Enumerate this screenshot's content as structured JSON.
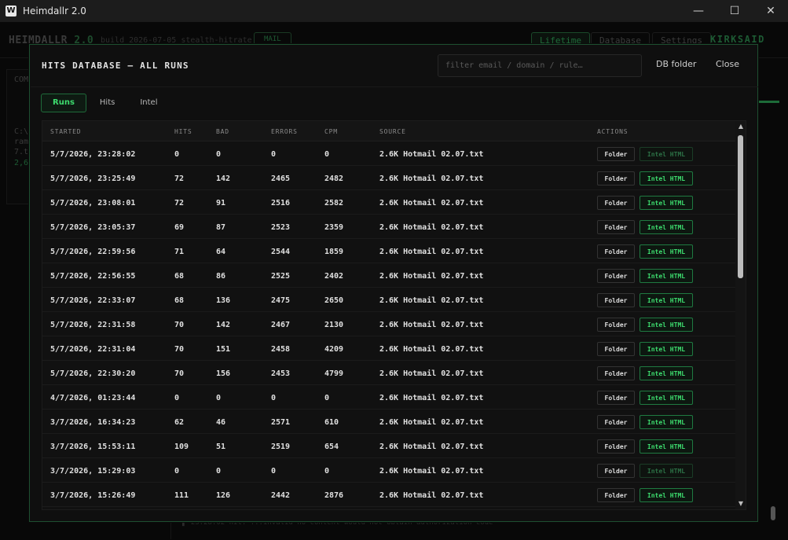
{
  "window": {
    "icon_letter": "W",
    "title": "Heimdallr 2.0",
    "minimize": "—",
    "maximize": "☐",
    "close": "✕"
  },
  "background": {
    "logo": "HEIMDALLR",
    "logo_version": "2.0",
    "build": "build 2026-07-05 stealth-hitrate",
    "mail_tag": "MAIL",
    "nav": {
      "lifetime": "Lifetime",
      "database": "Database",
      "settings": "Settings"
    },
    "user": "KIRKSAID",
    "side_texts": [
      "COM",
      "C:\\",
      "ram",
      "7.t",
      "2,6"
    ],
    "log_line": "▌ 23:28:02  hit: ...invalid  no content would not obtain authorization code"
  },
  "modal": {
    "title": "HITS DATABASE — ALL RUNS",
    "filter_placeholder": "filter email / domain / rule…",
    "filter_value": "",
    "db_folder": "DB folder",
    "close": "Close",
    "tabs": [
      {
        "label": "Runs",
        "active": true
      },
      {
        "label": "Hits",
        "active": false
      },
      {
        "label": "Intel",
        "active": false
      }
    ],
    "columns": {
      "started": "STARTED",
      "hits": "HITS",
      "bad": "BAD",
      "errors": "ERRORS",
      "cpm": "CPM",
      "source": "SOURCE",
      "actions": "ACTIONS"
    },
    "folder_label": "Folder",
    "intel_label": "Intel HTML",
    "rows": [
      {
        "started": "5/7/2026, 23:28:02",
        "hits": "0",
        "bad": "0",
        "errors": "0",
        "cpm": "0",
        "source": "2.6K Hotmail 02.07.txt",
        "intel_enabled": false
      },
      {
        "started": "5/7/2026, 23:25:49",
        "hits": "72",
        "bad": "142",
        "errors": "2465",
        "cpm": "2482",
        "source": "2.6K Hotmail 02.07.txt",
        "intel_enabled": true
      },
      {
        "started": "5/7/2026, 23:08:01",
        "hits": "72",
        "bad": "91",
        "errors": "2516",
        "cpm": "2582",
        "source": "2.6K Hotmail 02.07.txt",
        "intel_enabled": true
      },
      {
        "started": "5/7/2026, 23:05:37",
        "hits": "69",
        "bad": "87",
        "errors": "2523",
        "cpm": "2359",
        "source": "2.6K Hotmail 02.07.txt",
        "intel_enabled": true
      },
      {
        "started": "5/7/2026, 22:59:56",
        "hits": "71",
        "bad": "64",
        "errors": "2544",
        "cpm": "1859",
        "source": "2.6K Hotmail 02.07.txt",
        "intel_enabled": true
      },
      {
        "started": "5/7/2026, 22:56:55",
        "hits": "68",
        "bad": "86",
        "errors": "2525",
        "cpm": "2402",
        "source": "2.6K Hotmail 02.07.txt",
        "intel_enabled": true
      },
      {
        "started": "5/7/2026, 22:33:07",
        "hits": "68",
        "bad": "136",
        "errors": "2475",
        "cpm": "2650",
        "source": "2.6K Hotmail 02.07.txt",
        "intel_enabled": true
      },
      {
        "started": "5/7/2026, 22:31:58",
        "hits": "70",
        "bad": "142",
        "errors": "2467",
        "cpm": "2130",
        "source": "2.6K Hotmail 02.07.txt",
        "intel_enabled": true
      },
      {
        "started": "5/7/2026, 22:31:04",
        "hits": "70",
        "bad": "151",
        "errors": "2458",
        "cpm": "4209",
        "source": "2.6K Hotmail 02.07.txt",
        "intel_enabled": true
      },
      {
        "started": "5/7/2026, 22:30:20",
        "hits": "70",
        "bad": "156",
        "errors": "2453",
        "cpm": "4799",
        "source": "2.6K Hotmail 02.07.txt",
        "intel_enabled": true
      },
      {
        "started": "4/7/2026, 01:23:44",
        "hits": "0",
        "bad": "0",
        "errors": "0",
        "cpm": "0",
        "source": "2.6K Hotmail 02.07.txt",
        "intel_enabled": true
      },
      {
        "started": "3/7/2026, 16:34:23",
        "hits": "62",
        "bad": "46",
        "errors": "2571",
        "cpm": "610",
        "source": "2.6K Hotmail 02.07.txt",
        "intel_enabled": true
      },
      {
        "started": "3/7/2026, 15:53:11",
        "hits": "109",
        "bad": "51",
        "errors": "2519",
        "cpm": "654",
        "source": "2.6K Hotmail 02.07.txt",
        "intel_enabled": true
      },
      {
        "started": "3/7/2026, 15:29:03",
        "hits": "0",
        "bad": "0",
        "errors": "0",
        "cpm": "0",
        "source": "2.6K Hotmail 02.07.txt",
        "intel_enabled": false
      },
      {
        "started": "3/7/2026, 15:26:49",
        "hits": "111",
        "bad": "126",
        "errors": "2442",
        "cpm": "2876",
        "source": "2.6K Hotmail 02.07.txt",
        "intel_enabled": true
      }
    ],
    "scroll_up": "▲",
    "scroll_down": "▼"
  },
  "colors": {
    "accent": "#3ddc6e",
    "accent_border": "#1f7a41",
    "modal_border": "#1d4f30",
    "background": "#0b0b0b"
  }
}
